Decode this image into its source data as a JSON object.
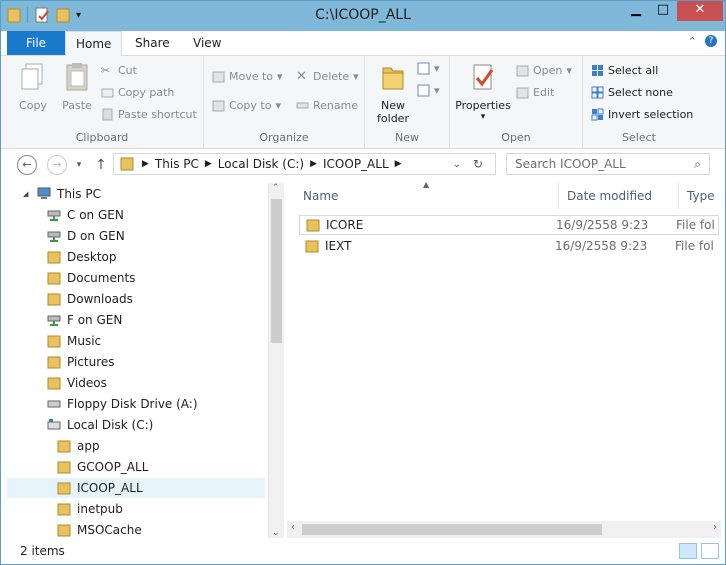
{
  "window": {
    "title": "C:\\ICOOP_ALL"
  },
  "ribbon_tabs": [
    {
      "label": "File"
    },
    {
      "label": "Home"
    },
    {
      "label": "Share"
    },
    {
      "label": "View"
    }
  ],
  "ribbon": {
    "clipboard": {
      "label": "Clipboard",
      "copy": "Copy",
      "paste": "Paste",
      "cut": "Cut",
      "copy_path": "Copy path",
      "paste_shortcut": "Paste shortcut"
    },
    "organize": {
      "label": "Organize",
      "move_to": "Move to",
      "copy_to": "Copy to",
      "delete": "Delete",
      "rename": "Rename"
    },
    "new": {
      "label": "New",
      "new_folder_line1": "New",
      "new_folder_line2": "folder"
    },
    "open": {
      "label": "Open",
      "properties": "Properties",
      "open": "Open",
      "edit": "Edit"
    },
    "select": {
      "label": "Select",
      "select_all": "Select all",
      "select_none": "Select none",
      "invert_selection": "Invert selection"
    }
  },
  "address": {
    "crumbs": [
      "This PC",
      "Local Disk (C:)",
      "ICOOP_ALL"
    ],
    "search_placeholder": "Search ICOOP_ALL"
  },
  "tree": [
    {
      "label": "This PC",
      "icon": "computer-icon",
      "level": 0
    },
    {
      "label": "C on GEN",
      "icon": "network-drive-icon",
      "level": 1
    },
    {
      "label": "D on GEN",
      "icon": "network-drive-icon",
      "level": 1
    },
    {
      "label": "Desktop",
      "icon": "folder-icon",
      "level": 1
    },
    {
      "label": "Documents",
      "icon": "folder-icon",
      "level": 1
    },
    {
      "label": "Downloads",
      "icon": "folder-icon",
      "level": 1
    },
    {
      "label": "F on GEN",
      "icon": "network-drive-icon",
      "level": 1
    },
    {
      "label": "Music",
      "icon": "folder-icon",
      "level": 1
    },
    {
      "label": "Pictures",
      "icon": "folder-icon",
      "level": 1
    },
    {
      "label": "Videos",
      "icon": "folder-icon",
      "level": 1
    },
    {
      "label": "Floppy Disk Drive (A:)",
      "icon": "floppy-icon",
      "level": 1
    },
    {
      "label": "Local Disk (C:)",
      "icon": "disk-icon",
      "level": 1
    },
    {
      "label": "app",
      "icon": "folder-icon",
      "level": 2
    },
    {
      "label": "GCOOP_ALL",
      "icon": "folder-icon",
      "level": 2
    },
    {
      "label": "ICOOP_ALL",
      "icon": "folder-icon",
      "level": 2,
      "selected": true
    },
    {
      "label": "inetpub",
      "icon": "folder-icon",
      "level": 2
    },
    {
      "label": "MSOCache",
      "icon": "folder-icon",
      "level": 2
    }
  ],
  "columns": {
    "name": "Name",
    "date": "Date modified",
    "type": "Type"
  },
  "files": [
    {
      "name": "ICORE",
      "date": "16/9/2558 9:23",
      "type": "File fol"
    },
    {
      "name": "IEXT",
      "date": "16/9/2558 9:23",
      "type": "File fol"
    }
  ],
  "status": {
    "count": "2 items"
  },
  "colors": {
    "titlebar": "#7fb8d8",
    "file_tab": "#1979ca",
    "close": "#c75050",
    "folder": "#e8c25c"
  }
}
